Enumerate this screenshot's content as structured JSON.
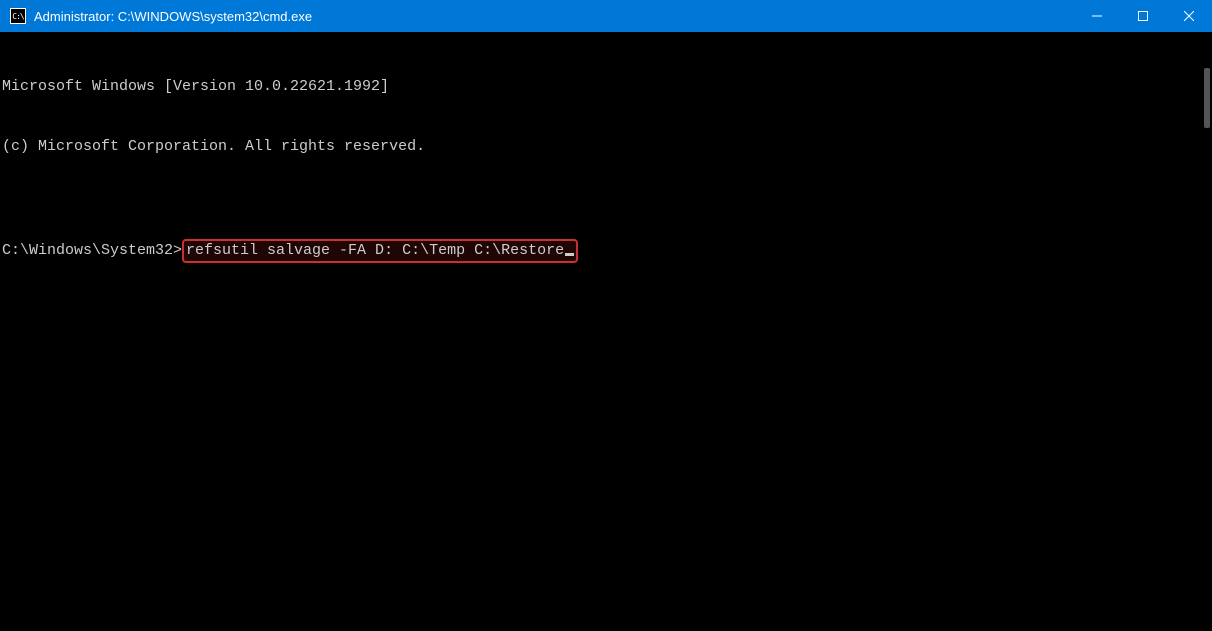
{
  "titlebar": {
    "icon_label": "C:\\",
    "title": "Administrator: C:\\WINDOWS\\system32\\cmd.exe"
  },
  "terminal": {
    "line1": "Microsoft Windows [Version 10.0.22621.1992]",
    "line2": "(c) Microsoft Corporation. All rights reserved.",
    "blank": "",
    "prompt": "C:\\Windows\\System32>",
    "command": "refsutil salvage -FA D: C:\\Temp C:\\Restore"
  }
}
